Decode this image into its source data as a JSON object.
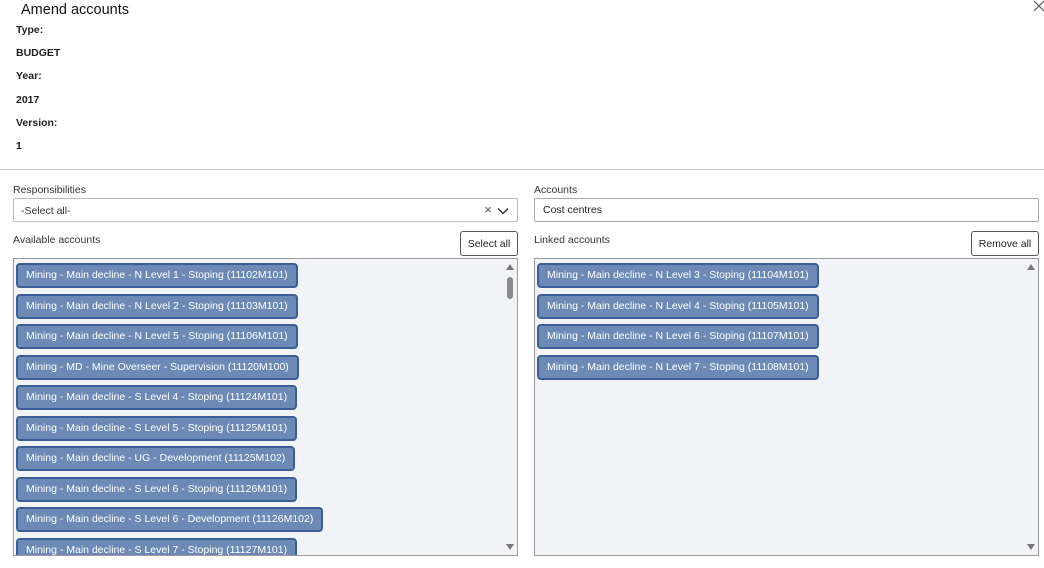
{
  "dialog": {
    "title": "Amend accounts"
  },
  "meta": {
    "type_label": "Type:",
    "type_value": "BUDGET",
    "year_label": "Year:",
    "year_value": "2017",
    "version_label": "Version:",
    "version_value": "1"
  },
  "responsibilities": {
    "label": "Responsibilities",
    "selected": "-Select all-",
    "clear_glyph": "×"
  },
  "accounts": {
    "label": "Accounts",
    "value": "Cost centres"
  },
  "available": {
    "label": "Available accounts",
    "select_all_label": "Select all",
    "items": [
      "Mining - Main decline - N Level 1 - Stoping (11102M101)",
      "Mining - Main decline - N Level 2 - Stoping (11103M101)",
      "Mining - Main decline - N Level 5 - Stoping (11106M101)",
      "Mining - MD - Mine Overseer - Supervision (11120M100)",
      "Mining - Main decline - S Level 4 - Stoping (11124M101)",
      "Mining - Main decline - S Level 5 - Stoping (11125M101)",
      "Mining - Main decline - UG - Development (11125M102)",
      "Mining - Main decline - S Level 6 - Stoping (11126M101)",
      "Mining - Main decline - S Level 6 - Development (11126M102)",
      "Mining - Main decline - S Level 7 - Stoping (11127M101)"
    ]
  },
  "linked": {
    "label": "Linked accounts",
    "remove_all_label": "Remove all",
    "items": [
      "Mining - Main decline - N Level 3 - Stoping (11104M101)",
      "Mining - Main decline - N Level 4 - Stoping (11105M101)",
      "Mining - Main decline - N Level 6 - Stoping (11107M101)",
      "Mining - Main decline - N Level 7 - Stoping (11108M101)"
    ]
  },
  "colors": {
    "chip_fill": "#6c8ab5",
    "chip_border": "#3a5f98",
    "list_background": "#f1f3f7"
  }
}
